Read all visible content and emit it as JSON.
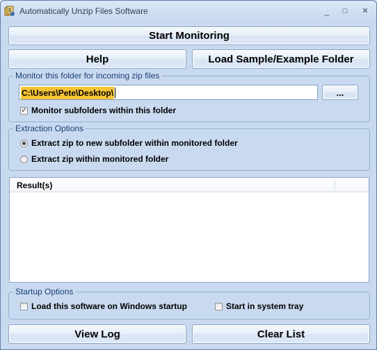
{
  "window": {
    "title": "Automatically Unzip Files Software",
    "controls": {
      "minimize": "_",
      "maximize": "□",
      "close": "✕"
    }
  },
  "toolbar": {
    "start_label": "Start Monitoring",
    "help_label": "Help",
    "load_sample_label": "Load Sample/Example Folder"
  },
  "monitor": {
    "legend": "Monitor this folder for incoming zip files",
    "folder_value": "C:\\Users\\Pete\\Desktop\\",
    "browse_label": "...",
    "subfolders_label": "Monitor subfolders within this folder",
    "subfolders_checked": true
  },
  "extraction": {
    "legend": "Extraction Options",
    "options": [
      {
        "label": "Extract zip to new subfolder within monitored folder",
        "selected": true
      },
      {
        "label": "Extract zip within monitored folder",
        "selected": false
      }
    ]
  },
  "results": {
    "columns": [
      "Result(s)"
    ],
    "rows": []
  },
  "startup": {
    "legend": "Startup Options",
    "load_on_startup_label": "Load this software on Windows startup",
    "system_tray_label": "Start in system tray"
  },
  "footer": {
    "view_log_label": "View Log",
    "clear_list_label": "Clear List"
  },
  "colors": {
    "window_bg": "#c9daf0",
    "group_label": "#1c3f73",
    "selection": "#f7c434"
  }
}
